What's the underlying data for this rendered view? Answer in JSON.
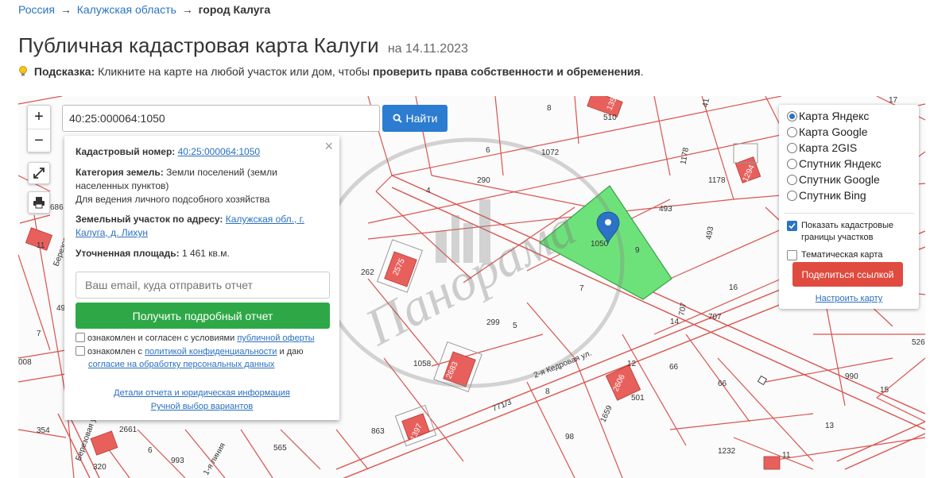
{
  "breadcrumb": {
    "items": [
      "Россия",
      "Калужская область"
    ],
    "separator": "→",
    "current": "город Калуга"
  },
  "page": {
    "title": "Публичная кадастровая карта Калуги",
    "date": "на 14.11.2023"
  },
  "hint": {
    "icon": "lightbulb-icon",
    "label": "Подсказка:",
    "text": "Кликните на карте на любой участок или дом, чтобы",
    "bold": "проверить права собственности и обременения",
    "end": "."
  },
  "map": {
    "zoom_in": "+",
    "zoom_out": "−",
    "search": {
      "value": "40:25:000064:1050",
      "button": "Найти"
    },
    "parcel_labels": [
      "8",
      "1351",
      "510",
      "41",
      "17",
      "6",
      "1072",
      "1178",
      "1178",
      "1294",
      "290",
      "4",
      "1050",
      "9",
      "493",
      "493",
      "686",
      "11",
      "262",
      "2575",
      "7",
      "16",
      "707",
      "707",
      "14",
      "299",
      "5",
      "49",
      "7",
      "1058",
      "2683",
      "12",
      "66",
      "66",
      "526",
      "990",
      "15",
      "008",
      "8",
      "501",
      "2606",
      "1659",
      "98",
      "13",
      "354",
      "2661",
      "863",
      "1397",
      "565",
      "1232",
      "11",
      "6",
      "993",
      "320",
      "771/3",
      "2-я Кедровая ул.",
      "Березовая",
      "Березовая ул.",
      "1-я линия"
    ],
    "colors": {
      "parcel_border": "#d9534f",
      "selected_parcel": "#6ee27a",
      "building": "#e8605c",
      "marker": "#2a73c6"
    },
    "watermark": "Панорама"
  },
  "info": {
    "cad_label": "Кадастровый номер:",
    "cad_value": "40:25:000064:1050",
    "cat_label": "Категория земель:",
    "cat_value_1": "Земли поселений (земли",
    "cat_value_2": "населенных пунктов)",
    "use": "Для ведения личного подсобного хозяйства",
    "addr_label": "Земельный участок по адресу:",
    "addr_value_1": "Калужская обл., г.",
    "addr_value_2": "Калуга, д. Лихун",
    "area_label": "Уточненная площадь:",
    "area_value": "1 461 кв.м.",
    "email_placeholder": "Ваш email, куда отправить отчет",
    "report_button": "Получить подробный отчет",
    "agree1_text": "ознакомлен и согласен с условиями",
    "agree1_link": "публичной оферты",
    "agree2_text": "ознакомлен с",
    "agree2_link": "политикой конфиденциальности",
    "agree2_mid": "и даю",
    "agree2_link2": "согласие на обработку персональных данных",
    "details_link": "Детали отчета и юридическая информация",
    "manual_link": "Ручной выбор вариантов"
  },
  "layers": {
    "options": [
      {
        "label": "Карта Яндекс",
        "selected": true
      },
      {
        "label": "Карта Google",
        "selected": false
      },
      {
        "label": "Карта 2GIS",
        "selected": false
      },
      {
        "label": "Спутник Яндекс",
        "selected": false
      },
      {
        "label": "Спутник Google",
        "selected": false
      },
      {
        "label": "Спутник Bing",
        "selected": false
      }
    ],
    "show_borders_1": "Показать кадастровые",
    "show_borders_2": "границы участков",
    "thematic": "Тематическая карта",
    "share_button": "Поделиться ссылкой",
    "setup_link": "Настроить карту"
  }
}
